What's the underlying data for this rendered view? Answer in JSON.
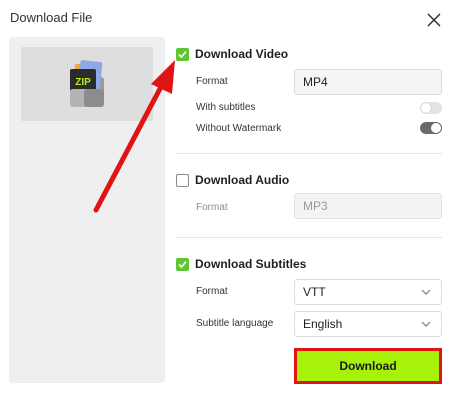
{
  "dialog": {
    "title": "Download File"
  },
  "preview": {
    "icon_label": "ZIP"
  },
  "video": {
    "label": "Download Video",
    "checked": true,
    "format_label": "Format",
    "format_value": "MP4",
    "subtitles_label": "With subtitles",
    "subtitles_on": false,
    "watermark_label": "Without Watermark",
    "watermark_on": true
  },
  "audio": {
    "label": "Download Audio",
    "checked": false,
    "format_label": "Format",
    "format_value": "MP3"
  },
  "subtitles": {
    "label": "Download Subtitles",
    "checked": true,
    "format_label": "Format",
    "format_value": "VTT",
    "language_label": "Subtitle language",
    "language_value": "English"
  },
  "actions": {
    "download_label": "Download"
  },
  "colors": {
    "check_green": "#5ec62e",
    "download_green": "#a6f20a",
    "highlight_red": "#e01414"
  }
}
